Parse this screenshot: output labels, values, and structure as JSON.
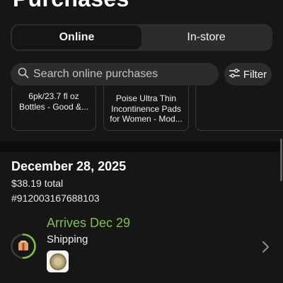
{
  "header": {
    "title": "Purchases"
  },
  "tabs": [
    {
      "label": "Online",
      "active": true
    },
    {
      "label": "In-store",
      "active": false
    }
  ],
  "search": {
    "placeholder": "Search online purchases",
    "value": ""
  },
  "filter": {
    "label": "Filter"
  },
  "carousel": {
    "items": [
      {
        "title": "6pk/23.7 fl oz Bottles - Good &..."
      },
      {
        "title": "Poise Ultra Thin Incontinence Pads for Women - Mod..."
      },
      {
        "title": ""
      }
    ]
  },
  "order": {
    "date": "December 28, 2025",
    "total": "$38.19 total",
    "number": "#912003167688103",
    "shipment": {
      "status": "Arrives Dec 29",
      "type": "Shipping",
      "progress": 0.5
    }
  },
  "colors": {
    "background": "#161616",
    "surface": "#2c2c2e",
    "accent_green": "#7cc14f",
    "text": "#ffffff"
  },
  "icons": [
    "search-icon",
    "filter-icon",
    "package-icon",
    "chevron-right-icon"
  ]
}
